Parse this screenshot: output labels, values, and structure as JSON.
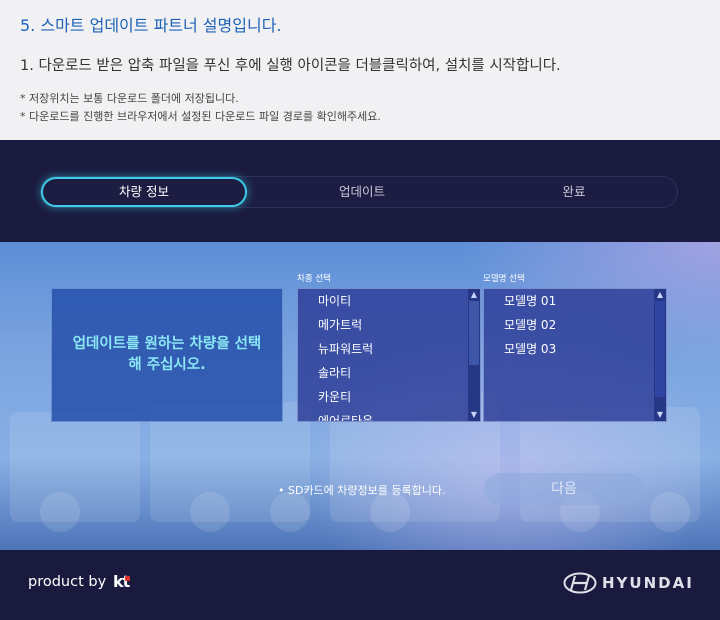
{
  "instructions": {
    "title": "5. 스마트 업데이트 파트너 설명입니다.",
    "step": "1. 다운로드 받은 압축 파일을 푸신 후에 실행 아이콘을 더블클릭하여, 설치를 시작합니다.",
    "notes": [
      "* 저장위치는 보통 다운로드 폴더에 저장됩니다.",
      "* 다운로드를 진행한 브라우저에서 설정된 다운로드 파일 경로를 확인해주세요."
    ]
  },
  "stepper": {
    "steps": [
      "차량 정보",
      "업데이트",
      "완료"
    ],
    "active": 0
  },
  "panel": {
    "prompt": "업데이트를 원하는 차량을 선택해 주십시오.",
    "vehicle_type_label": "차종 선택",
    "vehicle_types": [
      "마이티",
      "메가트럭",
      "뉴파워트럭",
      "솔라티",
      "카운티",
      "에어로타운"
    ],
    "model_label": "모델명 선택",
    "models": [
      "모델명 01",
      "모델명 02",
      "모델명 03"
    ],
    "register_note": "• SD카드에 차량정보를 등록합니다.",
    "next_label": "다음"
  },
  "footer": {
    "product_by": "product by",
    "kt_logo": "kt",
    "brand": "HYUNDAI"
  },
  "colors": {
    "accent": "#3ecde6",
    "title_blue": "#1d62b8",
    "app_bg": "#1a1a3e",
    "prompt_text": "#8be7f4"
  }
}
